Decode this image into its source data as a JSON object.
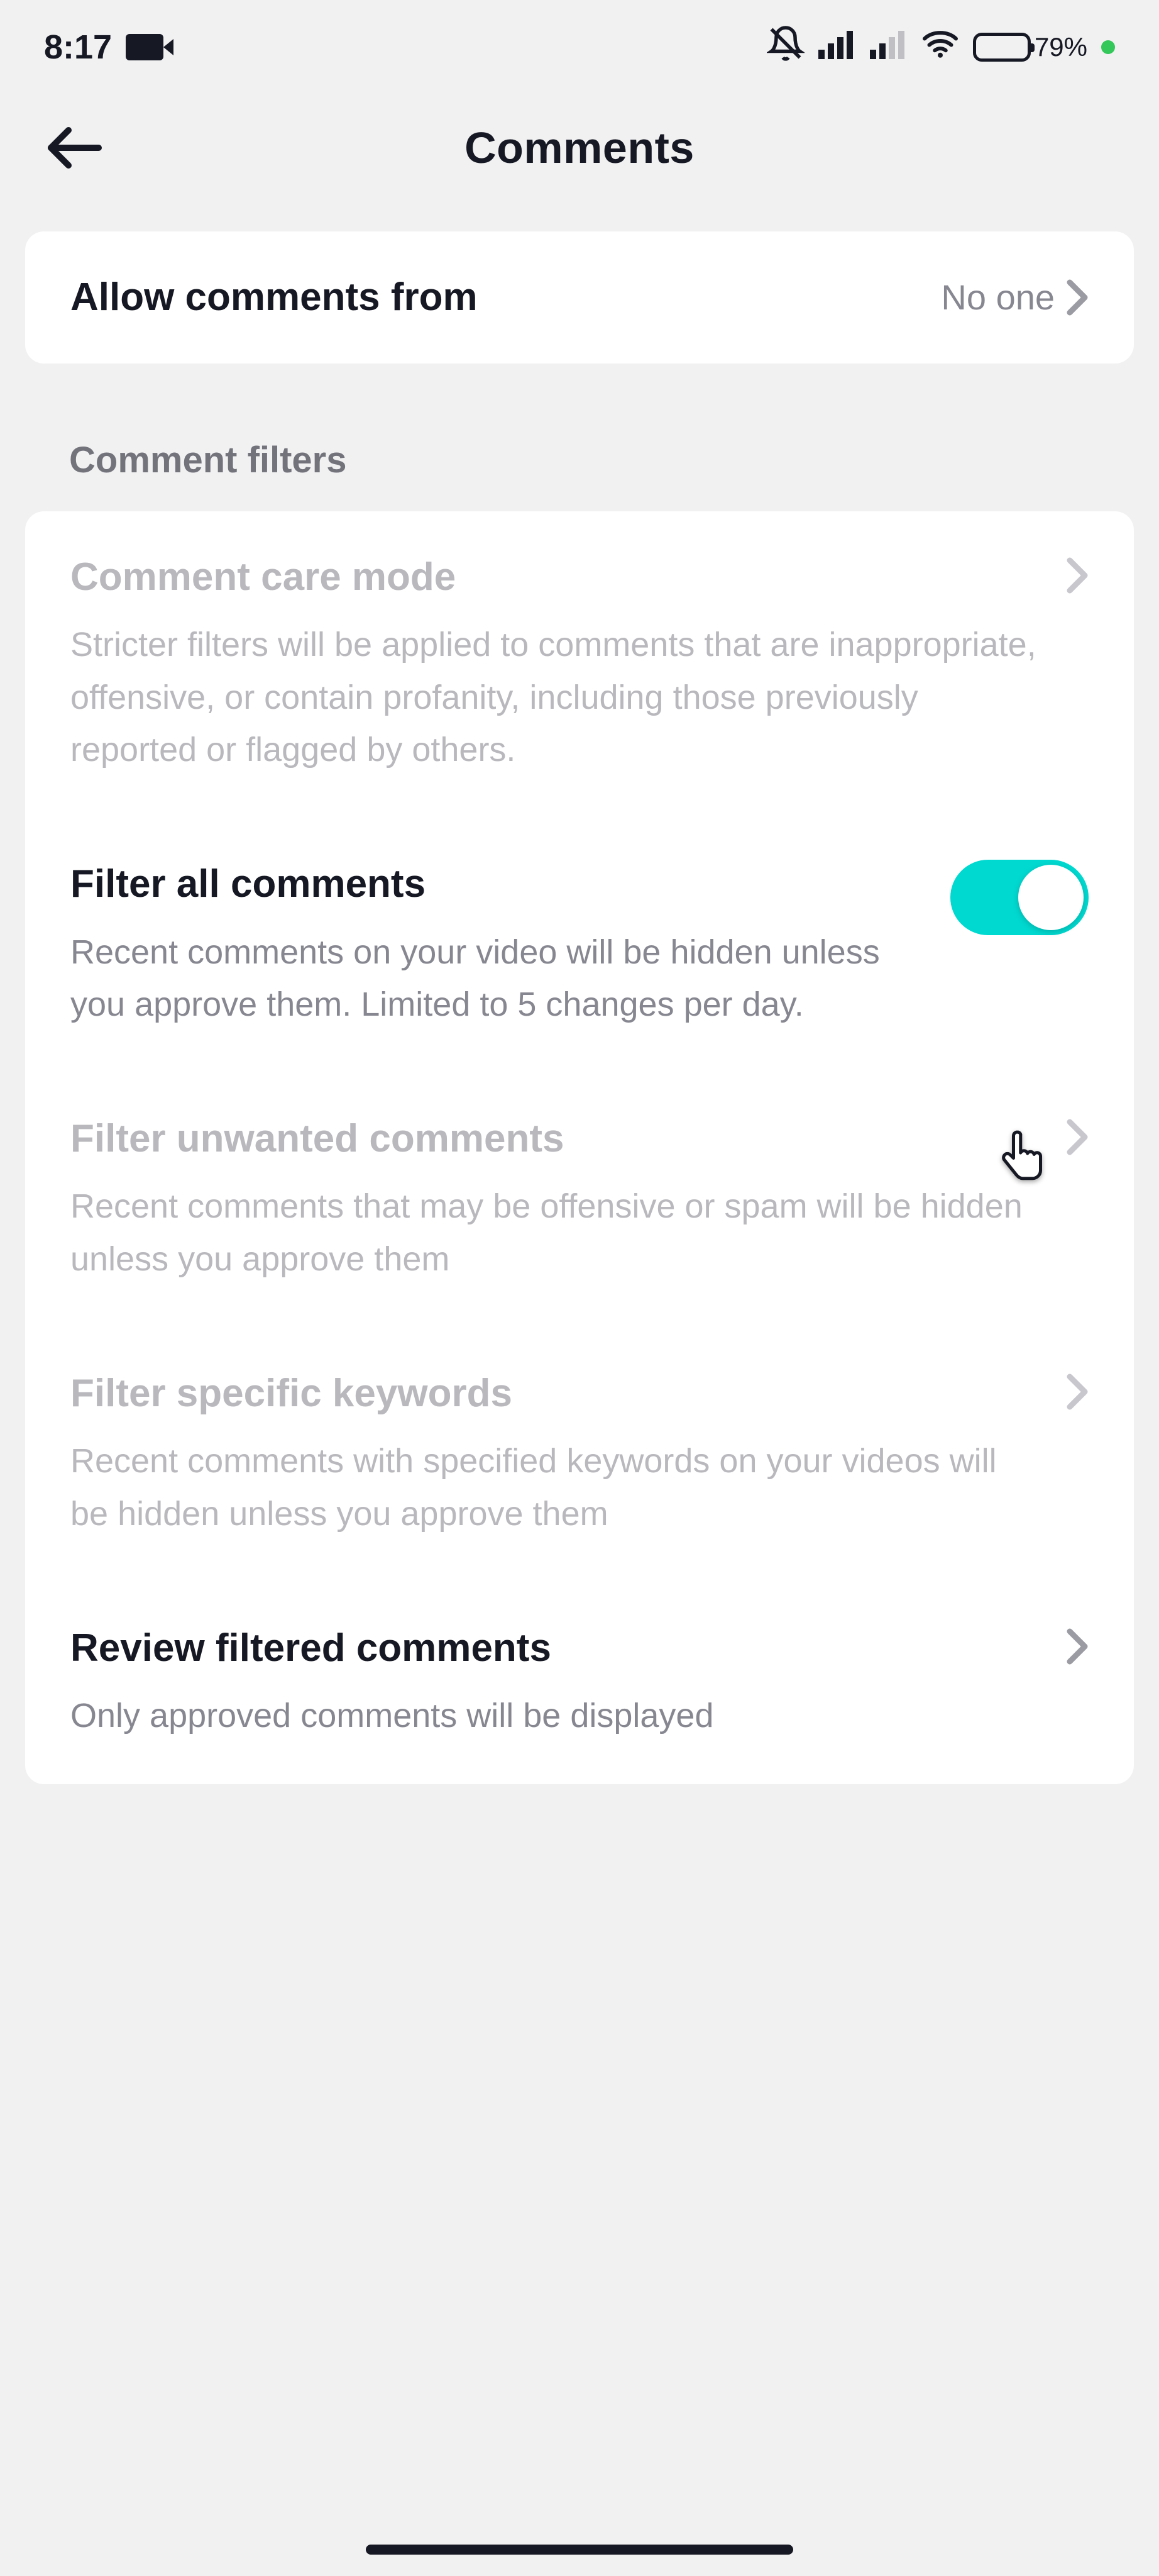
{
  "status": {
    "time": "8:17",
    "battery_text": "79%"
  },
  "header": {
    "title": "Comments"
  },
  "allow_row": {
    "title": "Allow comments from",
    "value": "No one"
  },
  "section_filters_header": "Comment filters",
  "filters": {
    "care_mode": {
      "title": "Comment care mode",
      "desc": "Stricter filters will be applied to comments that are inappropriate, offensive, or contain profanity, including those previously reported or flagged by others."
    },
    "filter_all": {
      "title": "Filter all comments",
      "desc": "Recent comments on your video will be hidden unless you approve them. Limited to 5 changes per day.",
      "enabled": true
    },
    "unwanted": {
      "title": "Filter unwanted comments",
      "desc": "Recent comments that may be offensive or spam will be hidden unless you approve them"
    },
    "keywords": {
      "title": "Filter specific keywords",
      "desc": "Recent comments with specified keywords on your videos will be hidden unless you approve them"
    },
    "review": {
      "title": "Review filtered comments",
      "desc": "Only approved comments will be displayed"
    }
  }
}
